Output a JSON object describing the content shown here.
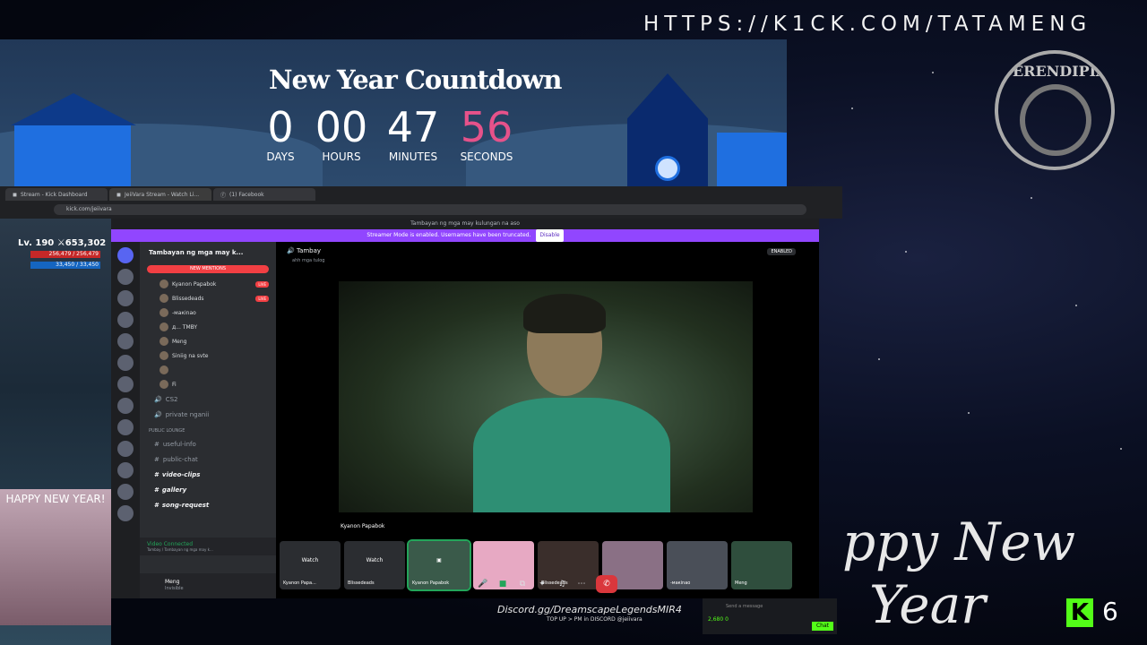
{
  "overlay": {
    "url_banner": "HTTPS://K1CK.COM/TATAMENG",
    "countdown": {
      "title": "New Year Countdown",
      "units": [
        {
          "value": "0",
          "label": "DAYS"
        },
        {
          "value": "00",
          "label": "HOURS"
        },
        {
          "value": "47",
          "label": "MINUTES"
        },
        {
          "value": "56",
          "label": "SECONDS",
          "color": "#e6528a"
        }
      ]
    },
    "logo_text": "SERENDIPIA",
    "script_text": "Happy New Year",
    "script_line1": "ppy New",
    "script_line2": "Year",
    "kick_badge": "K",
    "kick_count": "6",
    "left_cam_caption": "HAPPY NEW YEAR!",
    "discord_ad": "Discord.gg/DreamscapeLegendsMIR4",
    "topup_text": "TOP UP > PM in DISCORD @jeiivara"
  },
  "browser": {
    "tabs": [
      {
        "label": "Stream - Kick Dashboard"
      },
      {
        "label": "JeiiVara Stream - Watch Li..."
      },
      {
        "label": "(1) Facebook"
      }
    ],
    "address": "kick.com/jeiivara"
  },
  "game": {
    "level": "Lv. 190",
    "power": "653,302",
    "hp": "256,479 / 256,479",
    "mp": "33,450 / 33,450"
  },
  "discord": {
    "window_title": "Tambayan ng mga may kulungan na aso",
    "streamer_mode": "Streamer Mode is enabled. Usernames have been truncated.",
    "disable_label": "Disable",
    "server_name": "Tambayan ng mga may k...",
    "new_mentions": "NEW MENTIONS",
    "voice_users": [
      {
        "name": "Kyanon Papabok",
        "live": "LIVE"
      },
      {
        "name": "Blissedeads",
        "live": "LIVE"
      },
      {
        "name": "-макіnao",
        "live": ""
      },
      {
        "name": "д... TMBY",
        "live": ""
      },
      {
        "name": "Meng",
        "live": ""
      },
      {
        "name": "Siniig na svte",
        "live": ""
      },
      {
        "name": "",
        "live": ""
      },
      {
        "name": "Fi",
        "live": ""
      }
    ],
    "channels": [
      {
        "name": "CS2",
        "style": ""
      },
      {
        "name": "private nganii",
        "style": ""
      }
    ],
    "category": "PUBLIC LOUNGE",
    "text_channels": [
      {
        "name": "useful-info",
        "style": ""
      },
      {
        "name": "public-chat",
        "style": ""
      },
      {
        "name": "video-clips",
        "style": "bold"
      },
      {
        "name": "gallery",
        "style": "bold"
      },
      {
        "name": "song-request",
        "style": "bold"
      }
    ],
    "voice_connected": "Video Connected",
    "voice_connected_sub": "Tambay / Tambayan ng mga may k...",
    "user_name": "Meng",
    "user_status": "Invisible",
    "call_channel": "Tambay",
    "call_sub": "ahh mga tulog",
    "enabled_badge": "ENABLED",
    "main_video_label": "Kyanon Papabok",
    "tiles": [
      {
        "watch": "Watch",
        "name": "Kyanon Papa..."
      },
      {
        "watch": "Watch",
        "name": "Blissedeads"
      },
      {
        "watch": "",
        "name": "Kyanon Papabok"
      },
      {
        "watch": "",
        "name": ""
      },
      {
        "watch": "",
        "name": "Blissedeads"
      },
      {
        "watch": "",
        "name": ""
      },
      {
        "watch": "",
        "name": "-макіnao"
      },
      {
        "watch": "",
        "name": "Meng"
      }
    ]
  },
  "kick_chat": {
    "placeholder": "Send a message",
    "points": "2,680",
    "count": "0",
    "chat_label": "Chat"
  }
}
